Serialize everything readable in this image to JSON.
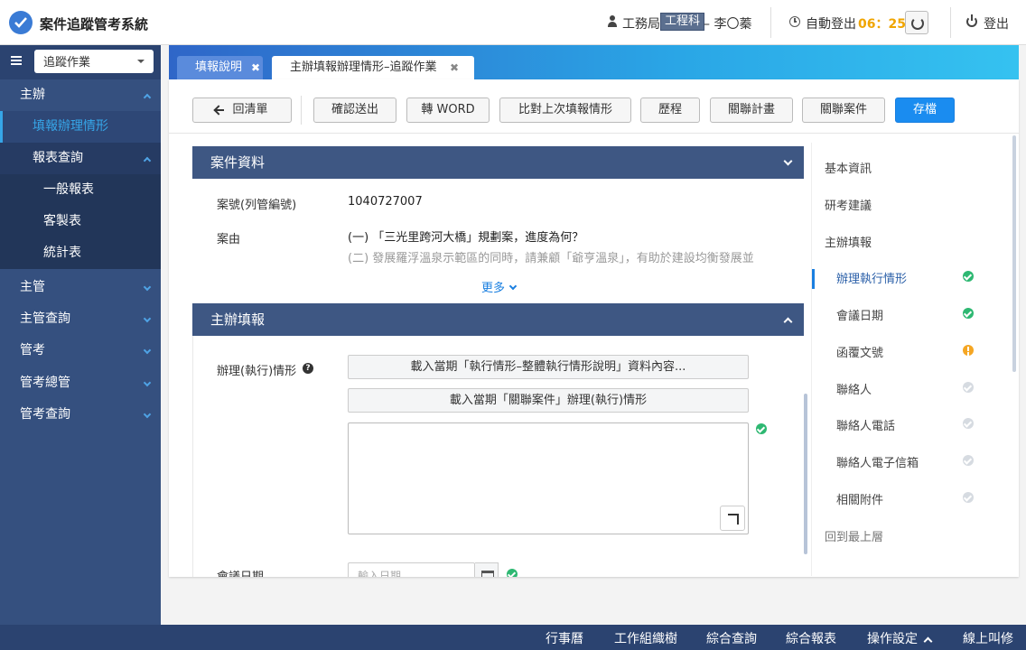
{
  "header": {
    "app_title": "案件追蹤管考系統",
    "dept": "工務局",
    "role_badge": "工程科",
    "user_name": "– 李〇蓁",
    "auto_logout_label": "自動登出",
    "auto_logout_time": "06：25",
    "logout_label": "登出"
  },
  "sidebar": {
    "selector_value": "追蹤作業",
    "items": [
      {
        "label": "主辦"
      },
      {
        "label": "填報辦理情形"
      },
      {
        "label": "報表查詢"
      },
      {
        "label": "一般報表"
      },
      {
        "label": "客製表"
      },
      {
        "label": "統計表"
      },
      {
        "label": "主管"
      },
      {
        "label": "主管查詢"
      },
      {
        "label": "管考"
      },
      {
        "label": "管考總管"
      },
      {
        "label": "管考查詢"
      }
    ]
  },
  "tabs": [
    {
      "label": "填報說明"
    },
    {
      "label": "主辦填報辦理情形–追蹤作業"
    }
  ],
  "toolbar": {
    "back": "回清單",
    "submit": "確認送出",
    "word": "轉 WORD",
    "compare": "比對上次填報情形",
    "history": "歷程",
    "plan": "關聯計畫",
    "cases": "關聯案件",
    "save": "存檔"
  },
  "case_section": {
    "title": "案件資料",
    "case_no_label": "案號(列管編號)",
    "case_no": "1040727007",
    "reason_label": "案由",
    "reason_1": "(一) 「三光里跨河大橋」規劃案，進度為何？",
    "reason_2": "(二) 發展羅浮溫泉示範區的同時，請兼顧「爺亨溫泉」，有助於建設均衡發展並",
    "more": "更多"
  },
  "report_section": {
    "title": "主辦填報",
    "exec_label": "辦理(執行)情形",
    "load_btn_1": "載入當期「執行情形–整體執行情形說明」資料內容...",
    "load_btn_2": "載入當期「關聯案件」辦理(執行)情形",
    "meeting_date_label": "會議日期",
    "date_placeholder": "輸入日期"
  },
  "right_nav": {
    "items": [
      {
        "label": "基本資訊"
      },
      {
        "label": "研考建議"
      },
      {
        "label": "主辦填報"
      },
      {
        "label": "辦理執行情形",
        "status": "ok"
      },
      {
        "label": "會議日期",
        "status": "ok"
      },
      {
        "label": "函覆文號",
        "status": "warning"
      },
      {
        "label": "聯絡人",
        "status": "pending"
      },
      {
        "label": "聯絡人電話",
        "status": "pending"
      },
      {
        "label": "聯絡人電子信箱",
        "status": "pending"
      },
      {
        "label": "相關附件",
        "status": "pending"
      },
      {
        "label": "回到最上層"
      }
    ]
  },
  "footer": {
    "items": [
      {
        "label": "行事曆"
      },
      {
        "label": "工作組織樹"
      },
      {
        "label": "綜合查詢"
      },
      {
        "label": "綜合報表"
      },
      {
        "label": "操作設定"
      },
      {
        "label": "線上叫修"
      }
    ]
  },
  "colors": {
    "accent": "#1a8cf0",
    "sidebar": "#35507f",
    "section_header": "#3e5783",
    "ok": "#2eb872",
    "warning": "#f5a623",
    "pending": "#d6dbe1",
    "auto_logout_time": "#f0a500"
  }
}
